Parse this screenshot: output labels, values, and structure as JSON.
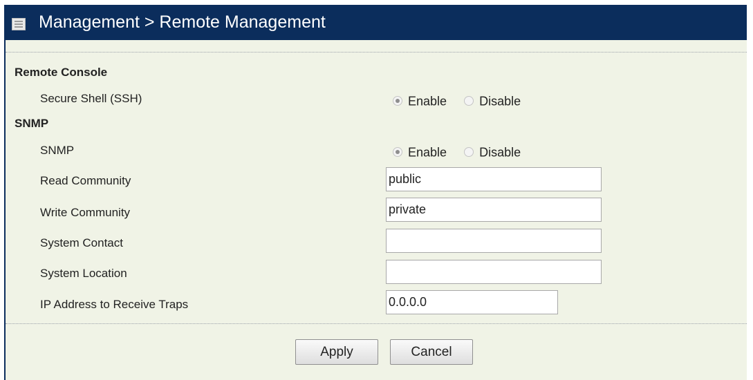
{
  "header": {
    "title": "Management > Remote Management"
  },
  "sections": {
    "remote_console": {
      "heading": "Remote Console",
      "ssh": {
        "label": "Secure Shell (SSH)",
        "selected": "Enable",
        "enable_label": "Enable",
        "disable_label": "Disable"
      }
    },
    "snmp": {
      "heading": "SNMP",
      "snmp_toggle": {
        "label": "SNMP",
        "selected": "Enable",
        "enable_label": "Enable",
        "disable_label": "Disable"
      },
      "read_community": {
        "label": "Read Community",
        "value": "public"
      },
      "write_community": {
        "label": "Write Community",
        "value": "private"
      },
      "system_contact": {
        "label": "System Contact",
        "value": ""
      },
      "system_location": {
        "label": "System Location",
        "value": ""
      },
      "trap_ip": {
        "label": "IP Address to Receive Traps",
        "value": "0.0.0.0"
      }
    }
  },
  "actions": {
    "apply_label": "Apply",
    "cancel_label": "Cancel"
  },
  "colors": {
    "header_bg": "#0b2d5c",
    "panel_bg": "#f0f3e6"
  }
}
